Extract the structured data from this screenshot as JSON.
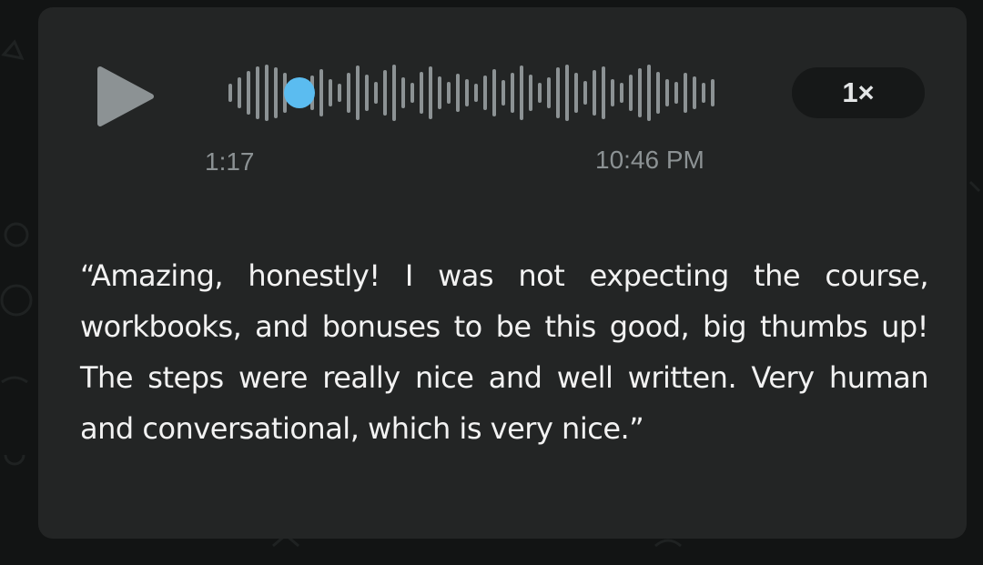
{
  "voice_message": {
    "duration": "1:17",
    "timestamp": "10:46 PM",
    "speed": "1×",
    "progress": 0.15,
    "colors": {
      "bubble": "#232525",
      "played_dot": "#5bbcf0",
      "waveform": "#8c9294",
      "text": "#f2f2f2"
    },
    "play_icon": "play-icon"
  },
  "message": {
    "text": "“Amazing, honestly! I was not expecting the course, workbooks, and bonuses to be this good, big thumbs up! The steps were really nice and well written. Very human and conversational, which is very nice.”"
  }
}
